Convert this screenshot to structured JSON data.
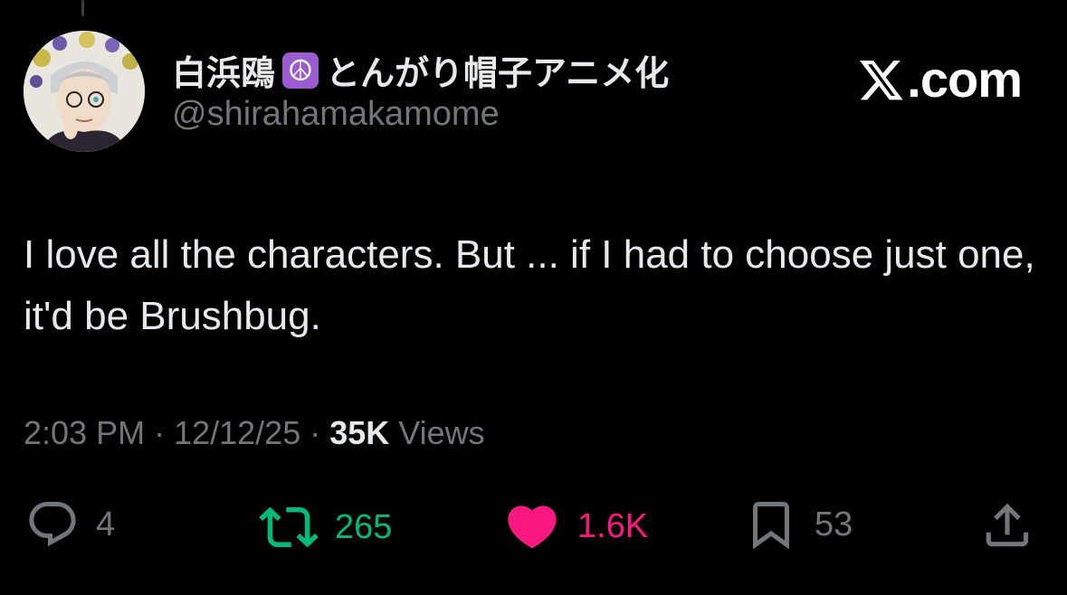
{
  "author": {
    "name_before": "白浜鴎",
    "name_emoji": "☮",
    "name_after": "とんがり帽子アニメ化",
    "handle": "@shirahamakamome",
    "avatar_icon": "avatar-illustration"
  },
  "brand": {
    "label": ".com",
    "icon": "x-logo-icon"
  },
  "tweet": {
    "text": "I love all the characters. But ... if I had to choose just one, it'd be Brushbug."
  },
  "meta": {
    "time": "2:03 PM",
    "separator": " · ",
    "date": "12/12/25",
    "views_count": "35K",
    "views_label": " Views"
  },
  "actions": {
    "replies": "4",
    "retweets": "265",
    "likes": "1.6K",
    "bookmarks": "53"
  },
  "colors": {
    "background": "#000000",
    "text": "#e7e9ea",
    "muted": "#71767b",
    "retweet": "#00ba7c",
    "like": "#f91880",
    "emoji_bg": "#9c5bd0"
  }
}
